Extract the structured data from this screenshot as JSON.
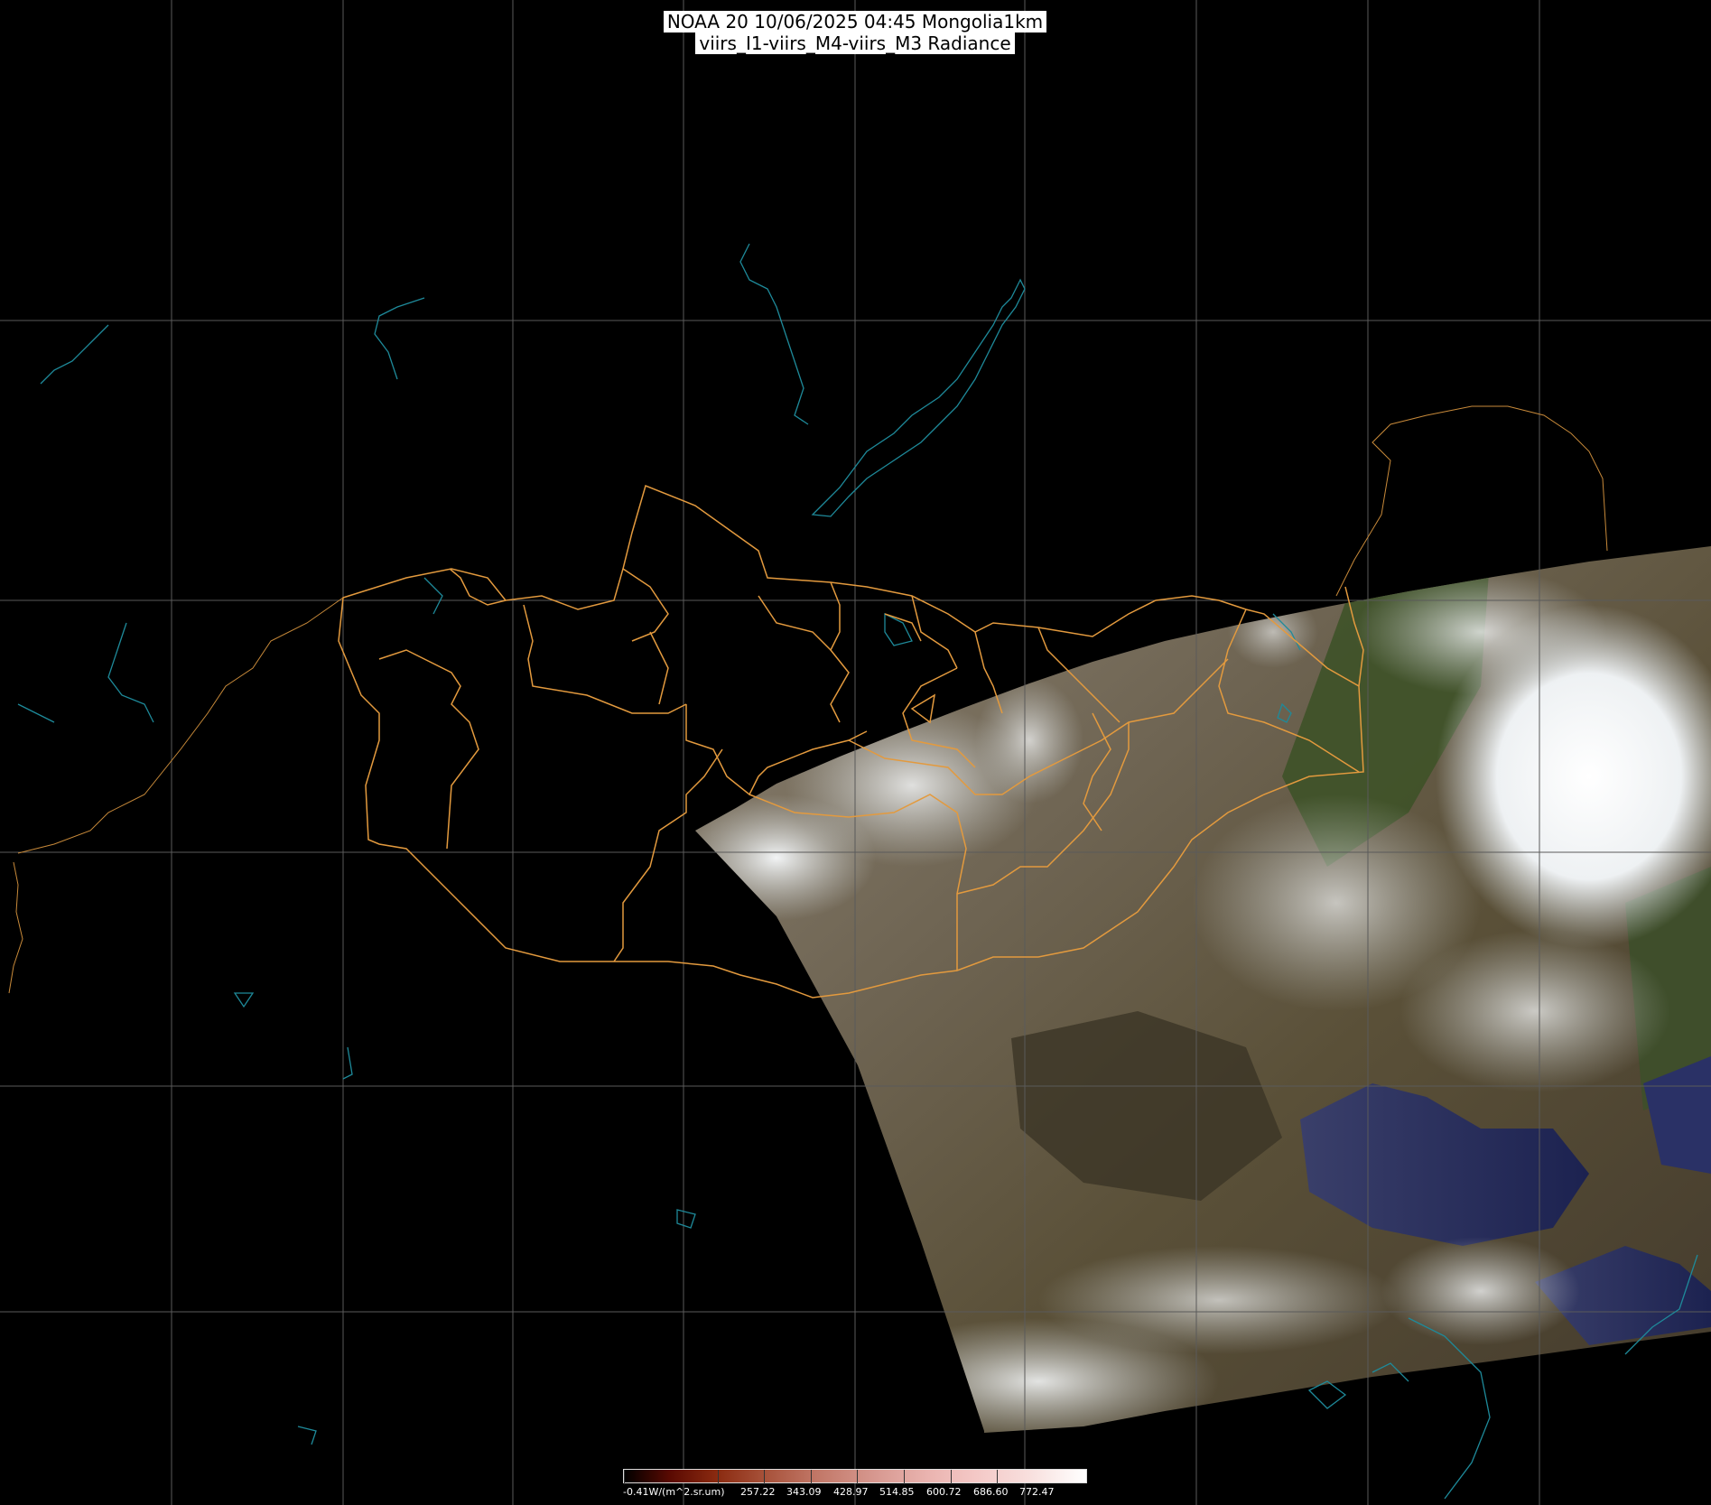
{
  "title": {
    "line1": "NOAA 20 10/06/2025 04:45 Mongolia1km",
    "line2": "viirs_I1-viirs_M4-viirs_M3 Radiance"
  },
  "colorbar": {
    "labels": [
      "-0.41W/(m^2.sr.um)",
      "257.22",
      "343.09",
      "428.97",
      "514.85",
      "600.72",
      "686.60",
      "772.47"
    ],
    "colors": [
      "#000000",
      "#5a0a02",
      "#8a2a10",
      "#c27868",
      "#eab4b0",
      "#ffffff"
    ]
  },
  "map": {
    "gridline_color": "#5a5a5a",
    "border_color": "#e39a3e",
    "coastline_color": "#1e8a9a",
    "background": "#000000"
  }
}
